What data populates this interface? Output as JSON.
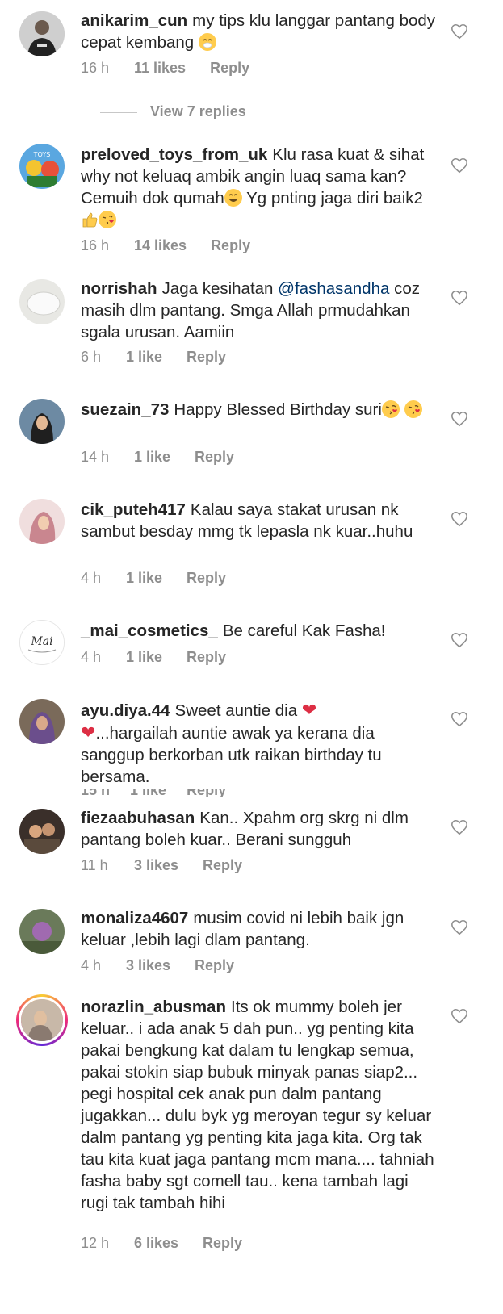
{
  "comments": [
    {
      "username": "anikarim_cun",
      "text": "my tips klu langgar pantang body cepat kembang",
      "emoji_after": "😷",
      "time": "16 h",
      "likes": "11 likes",
      "reply": "Reply",
      "view_replies": "View 7 replies"
    },
    {
      "username": "preloved_toys_from_uk",
      "text": "Klu rasa kuat & sihat why not keluaq ambik angin luaq sama kan? Cemuih dok qumah",
      "text2": " Yg pnting jaga diri baik2",
      "time": "16 h",
      "likes": "14 likes",
      "reply": "Reply"
    },
    {
      "username": "norrishah",
      "text_pre": "Jaga kesihatan ",
      "mention": "@fashasandha",
      "text": " coz masih dlm pantang. Smga Allah prmudahkan sgala urusan. Aamiin",
      "time": "6 h",
      "likes": "1 like",
      "reply": "Reply"
    },
    {
      "username": "suezain_73",
      "text": "Happy Blessed Birthday suri",
      "time": "14 h",
      "likes": "1 like",
      "reply": "Reply"
    },
    {
      "username": "cik_puteh417",
      "text": "Kalau saya stakat urusan nk sambut besday mmg tk lepasla nk kuar..huhu",
      "time": "4 h",
      "likes": "1 like",
      "reply": "Reply"
    },
    {
      "username": "_mai_cosmetics_",
      "text": "Be careful Kak Fasha!",
      "time": "4 h",
      "likes": "1 like",
      "reply": "Reply",
      "avatar_text": "Mai"
    },
    {
      "username": "ayu.diya.44",
      "text": "Sweet auntie dia",
      "text2": "...hargailah auntie awak ya kerana dia sanggup berkorban utk raikan birthday tu bersama."
    },
    {
      "username": "fiezaabuhasan",
      "text": "Kan.. Xpahm org skrg ni dlm pantang boleh kuar.. Berani sungguh",
      "time": "11 h",
      "likes": "3 likes",
      "reply": "Reply"
    },
    {
      "username": "monaliza4607",
      "text": "musim covid ni lebih baik jgn keluar ,lebih lagi dlam pantang.",
      "time": "4 h",
      "likes": "3 likes",
      "reply": "Reply"
    },
    {
      "username": "norazlin_abusman",
      "text": "Its ok mummy boleh jer keluar.. i ada anak 5 dah pun.. yg penting kita pakai bengkung kat dalam tu lengkap semua, pakai stokin siap bubuk minyak panas siap2... pegi hospital cek anak pun dalm pantang jugakkan... dulu byk yg meroyan tegur sy keluar dalm pantang yg penting kita jaga kita. Org tak tau kita kuat jaga pantang mcm mana.... tahniah fasha baby sgt comell tau.. kena tambah lagi rugi tak tambah hihi",
      "time": "12 h",
      "likes": "6 likes",
      "reply": "Reply"
    }
  ],
  "colors": {
    "text": "#262626",
    "meta": "#8e8e8e",
    "mention": "#003569",
    "heart_outline": "#8e8e8e",
    "red_heart": "#dd2e44"
  }
}
